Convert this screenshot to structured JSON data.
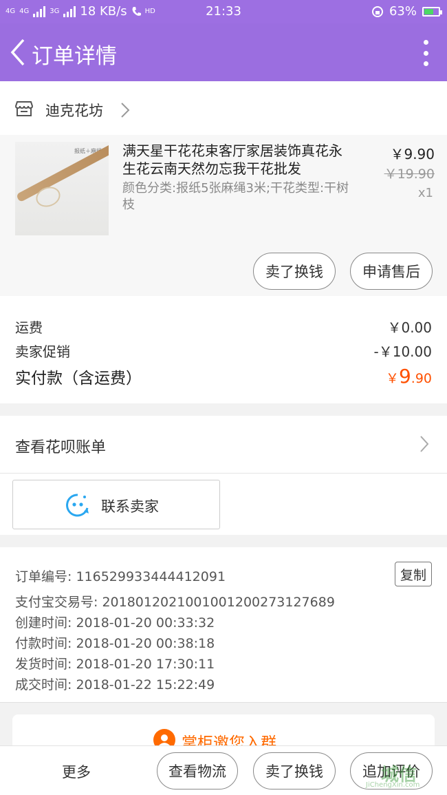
{
  "status_bar": {
    "signal_a": "4G",
    "signal_b": "4G",
    "signal_c": "3G",
    "network_speed": "18 KB/s",
    "hd_label": "HD",
    "time": "21:33",
    "battery": "63%",
    "battery_level": 0.63
  },
  "nav": {
    "title": "订单详情"
  },
  "shop": {
    "name": "迪克花坊"
  },
  "item": {
    "image_caption": "报纸＋麻绳",
    "title": "满天星干花花束客厅家居装饰真花永生花云南天然勿忘我干花批发",
    "sku": "颜色分类:报纸5张麻绳3米;干花类型:干树枝",
    "price": "￥9.90",
    "original_price": "￥19.90",
    "quantity": "x1",
    "buttons": {
      "sell": "卖了换钱",
      "after_sale": "申请售后"
    }
  },
  "fees": {
    "shipping_label": "运费",
    "shipping_value": "￥0.00",
    "promo_label": "卖家促销",
    "promo_value": "-￥10.00",
    "paid_label": "实付款（含运费）",
    "paid_currency": "￥",
    "paid_integer": "9",
    "paid_decimal": ".90"
  },
  "huabei": {
    "label": "查看花呗账单"
  },
  "contact": {
    "label": "联系卖家"
  },
  "order_info": {
    "order_no": "订单编号: 116529933444412091",
    "alipay_no": "支付宝交易号: 2018012021001001200273127689",
    "created": "创建时间: 2018-01-20 00:33:32",
    "paid": "付款时间: 2018-01-20 00:38:18",
    "shipped": "发货时间: 2018-01-20 17:30:11",
    "completed": "成交时间: 2018-01-22 15:22:49",
    "copy_label": "复制"
  },
  "group_card": {
    "label": "掌柜邀您入群"
  },
  "bottom_bar": {
    "more": "更多",
    "logistics": "查看物流",
    "sell": "卖了换钱",
    "review": "追加评价"
  },
  "watermark": {
    "logo_text": "城信",
    "sub_text": "JiChengXin.com"
  },
  "colors": {
    "header": "#9b6ee0",
    "accent_price": "#ff5000",
    "group_orange": "#ff6a00",
    "contact_blue": "#2aa7f0"
  }
}
